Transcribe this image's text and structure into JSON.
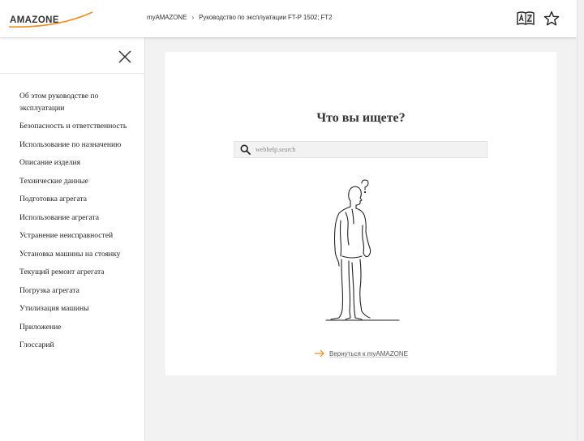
{
  "header": {
    "logo_text": "AMAZONE",
    "breadcrumb": [
      {
        "label": "myAMAZONE"
      },
      {
        "label": "Руководство по эксплуатации FT-P 1502; FT2"
      }
    ],
    "breadcrumb_separator": "›",
    "icons": [
      "dictionary-icon",
      "star-icon"
    ]
  },
  "sidebar": {
    "close_icon": "close-icon",
    "items": [
      {
        "label": "Об этом руководстве по эксплуатации"
      },
      {
        "label": "Безопасность и ответственность"
      },
      {
        "label": "Использование по назначению"
      },
      {
        "label": "Описание изделия"
      },
      {
        "label": "Технические данные"
      },
      {
        "label": "Подготовка агрегата"
      },
      {
        "label": "Использование агрегата"
      },
      {
        "label": "Устранение неисправностей"
      },
      {
        "label": "Установка машины на стоянку"
      },
      {
        "label": "Текущий ремонт агрегата"
      },
      {
        "label": "Погрузка агрегата"
      },
      {
        "label": "Утилизация машины"
      },
      {
        "label": "Приложение"
      },
      {
        "label": "Глоссарий"
      }
    ]
  },
  "main": {
    "heading": "Что вы ищете?",
    "search": {
      "placeholder": "webhelp.search",
      "value": ""
    },
    "back_link": "Вернуться к myAMAZONE"
  },
  "colors": {
    "accent": "#f08c1e",
    "text": "#222222",
    "background": "#f2f2f2"
  }
}
